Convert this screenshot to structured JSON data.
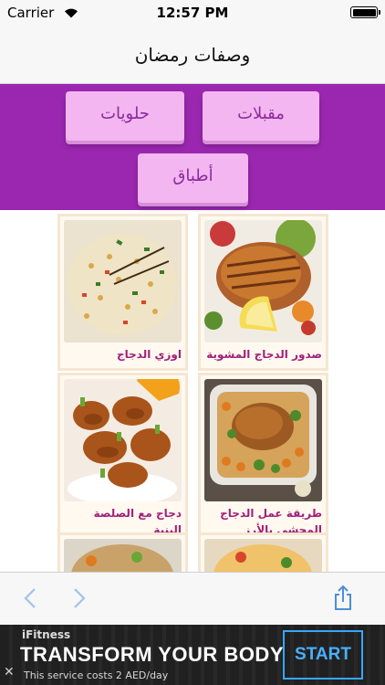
{
  "status_bar": {
    "carrier": "Carrier",
    "time": "12:57 PM",
    "icons": [
      "wifi-icon",
      "battery-icon"
    ]
  },
  "nav_bar": {
    "title": "وصفات رمضان"
  },
  "categories": [
    {
      "label": "مقبلات"
    },
    {
      "label": "حلويات"
    },
    {
      "label": "أطباق"
    }
  ],
  "colors": {
    "panel_purple": "#9b27b0",
    "button_pink": "#f3b6f0",
    "recipe_title": "#a21f7a",
    "toolbar_blue": "#4a90d9"
  },
  "recipes": [
    {
      "name": "صدور الدجاج المشوية",
      "image": "grilled-chicken-breast-image"
    },
    {
      "name": "اوزي الدجاج",
      "image": "chicken-ouzi-rice-image"
    },
    {
      "name": "طريقة عمل الدجاج المحشي بالأرز",
      "image": "stuffed-chicken-image"
    },
    {
      "name": "دجاج مع الصلصة البنية",
      "image": "chicken-brown-sauce-image"
    },
    {
      "name": "",
      "image": "recipe-image"
    },
    {
      "name": "",
      "image": "recipe-image"
    }
  ],
  "toolbar": {
    "back_icon": "chevron-left-icon",
    "forward_icon": "chevron-right-icon",
    "share_icon": "share-icon"
  },
  "ad": {
    "brand": "iFitness",
    "headline": "TRANSFORM YOUR BODY",
    "subtext": "This service costs 2 AED/day",
    "cta": "START",
    "close": "✕"
  }
}
